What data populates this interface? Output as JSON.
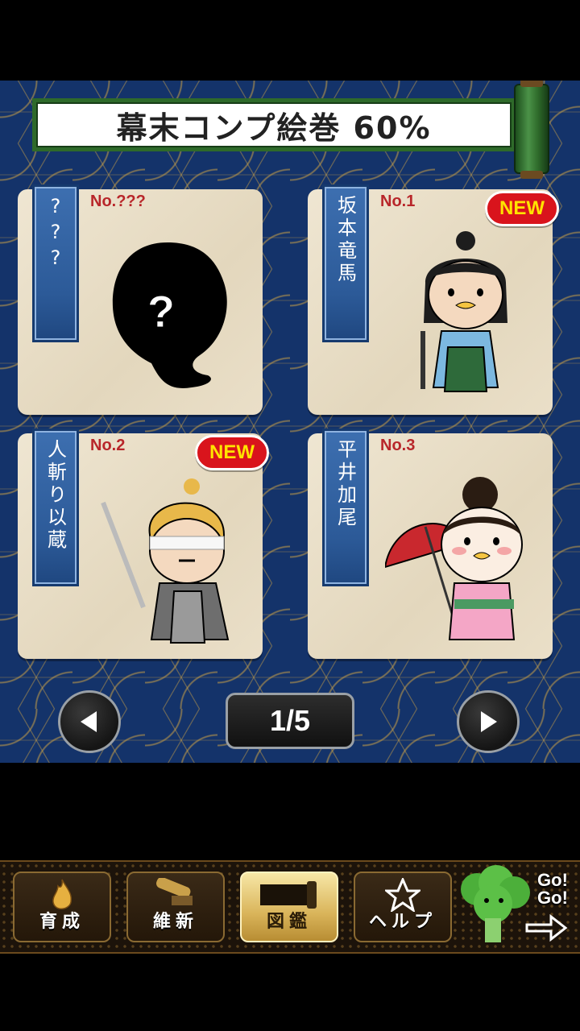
{
  "header": {
    "title": "幕末コンプ絵巻 60%"
  },
  "cards": [
    {
      "name": "???",
      "number": "No.???",
      "is_new": false
    },
    {
      "name": "坂本竜馬",
      "number": "No.1",
      "is_new": true
    },
    {
      "name": "人斬り以蔵",
      "number": "No.2",
      "is_new": true
    },
    {
      "name": "平井加尾",
      "number": "No.3",
      "is_new": false
    }
  ],
  "badge": {
    "new_label": "NEW"
  },
  "pager": {
    "current": "1/5"
  },
  "bottom_nav": {
    "items": [
      {
        "label": "育成",
        "icon": "flame-icon",
        "active": false
      },
      {
        "label": "維新",
        "icon": "cannon-icon",
        "active": false
      },
      {
        "label": "図鑑",
        "icon": "scroll-icon",
        "active": true
      },
      {
        "label": "ヘルプ",
        "icon": "star-icon",
        "active": false
      }
    ],
    "promo_text": "Go! Go!"
  },
  "colors": {
    "background": "#14336a",
    "ribbon": "#2c5a98",
    "badge": "#d9141c",
    "active_tab": "#d9b45a"
  }
}
